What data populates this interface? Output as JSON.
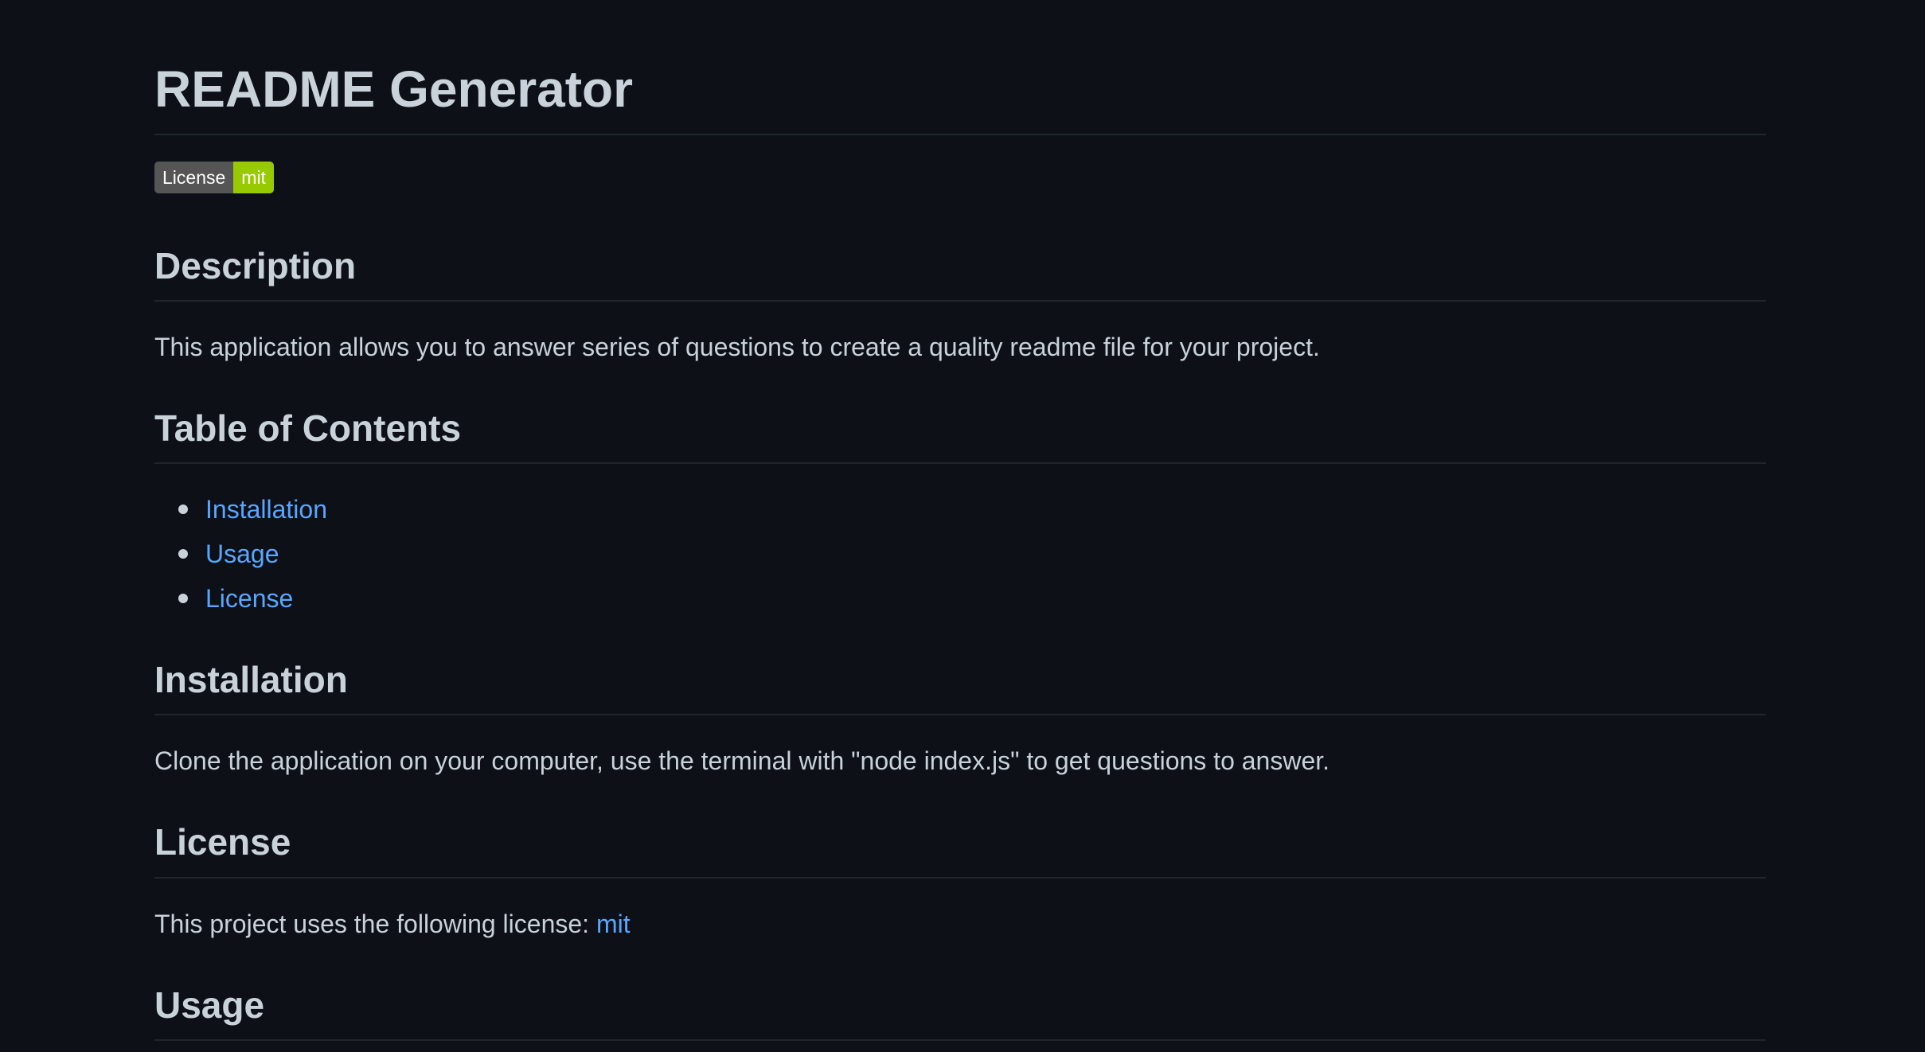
{
  "title": "README Generator",
  "badge": {
    "label": "License",
    "value": "mit",
    "value_color": "#97ca00"
  },
  "description": {
    "heading": "Description",
    "text": "This application allows you to answer series of questions to create a quality readme file for your project."
  },
  "toc": {
    "heading": "Table of Contents",
    "items": [
      "Installation",
      "Usage",
      "License"
    ]
  },
  "installation": {
    "heading": "Installation",
    "text": "Clone the application on your computer, use the terminal with \"node index.js\" to get questions to answer."
  },
  "license": {
    "heading": "License",
    "text": "This project uses the following license: ",
    "link": "mit"
  },
  "usage": {
    "heading": "Usage"
  },
  "colors": {
    "background": "#0d1117",
    "text": "#c9d1d9",
    "link": "#58a6ff",
    "divider": "#21262d"
  }
}
